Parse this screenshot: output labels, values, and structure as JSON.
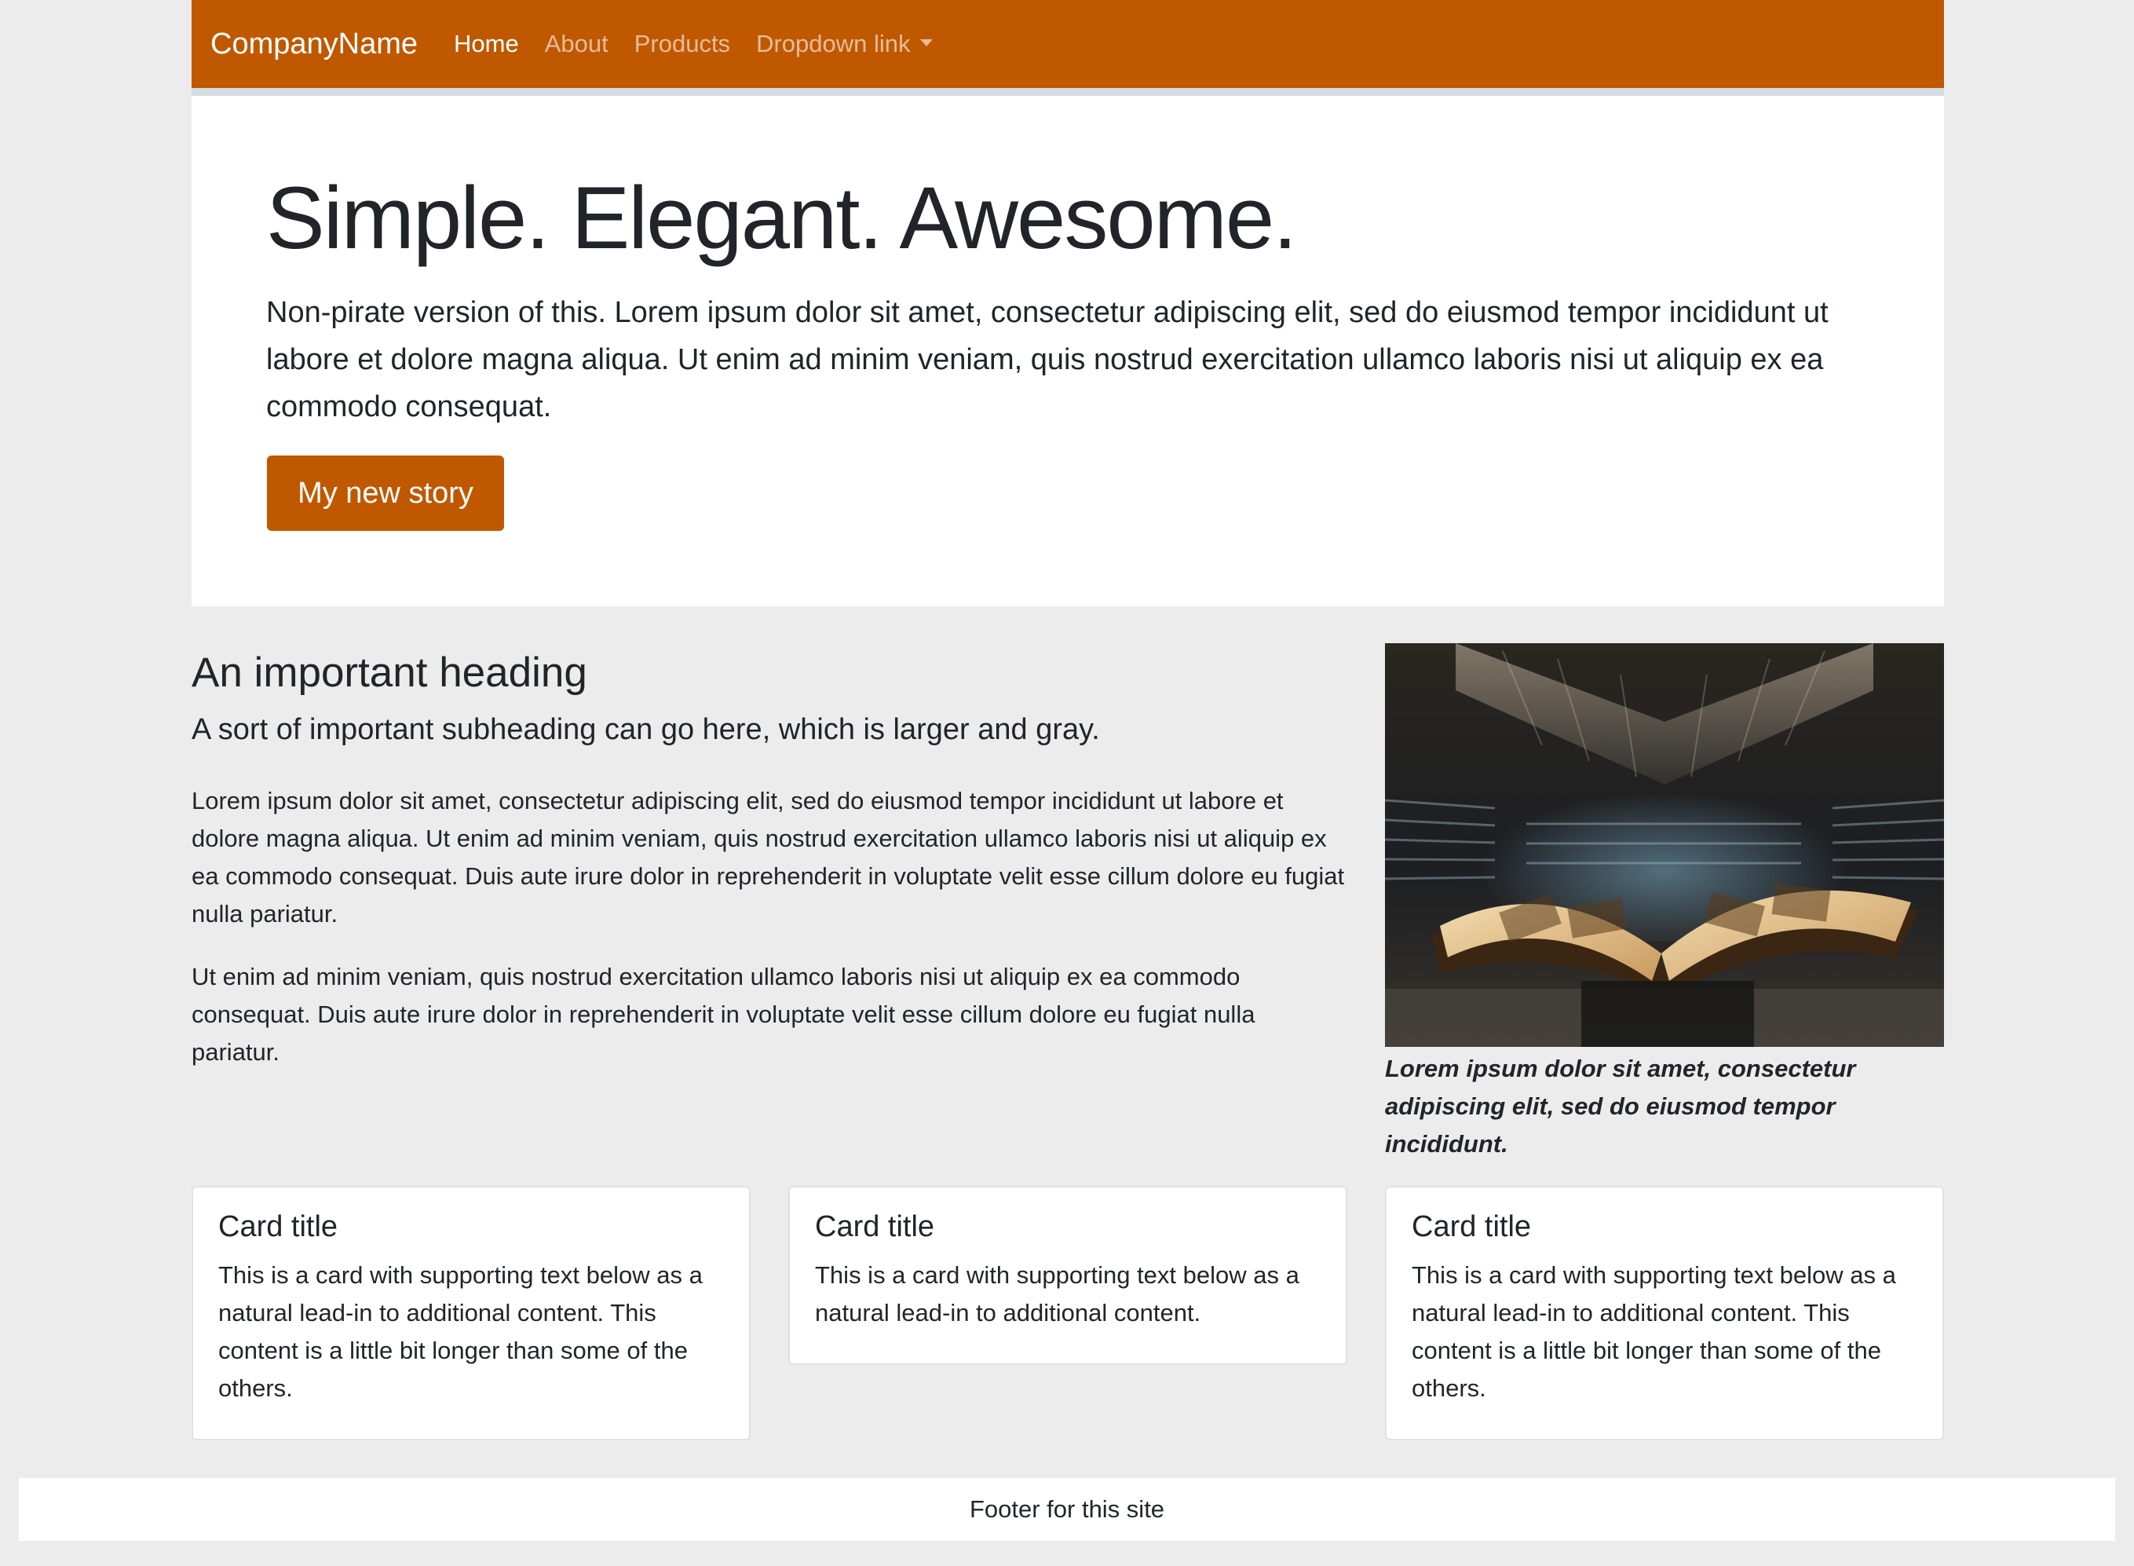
{
  "navbar": {
    "brand": "CompanyName",
    "items": [
      {
        "label": "Home",
        "active": true
      },
      {
        "label": "About",
        "active": false
      },
      {
        "label": "Products",
        "active": false
      },
      {
        "label": "Dropdown link",
        "active": false,
        "dropdown": true
      }
    ],
    "accent_color": "#c05800"
  },
  "hero": {
    "title": "Simple. Elegant. Awesome.",
    "text": "Non-pirate version of this. Lorem ipsum dolor sit amet, consectetur adipiscing elit, sed do eiusmod tempor incididunt ut labore et dolore magna aliqua. Ut enim ad minim veniam, quis nostrud exercitation ullamco laboris nisi ut aliquip ex ea commodo consequat.",
    "button_label": "My new story"
  },
  "content": {
    "heading": "An important heading",
    "subheading": "A sort of important subheading can go here, which is larger and gray.",
    "paragraphs": [
      "Lorem ipsum dolor sit amet, consectetur adipiscing elit, sed do eiusmod tempor incididunt ut labore et dolore magna aliqua. Ut enim ad minim veniam, quis nostrud exercitation ullamco laboris nisi ut aliquip ex ea commodo consequat. Duis aute irure dolor in reprehenderit in voluptate velit esse cillum dolore eu fugiat nulla pariatur.",
      "Ut enim ad minim veniam, quis nostrud exercitation ullamco laboris nisi ut aliquip ex ea commodo consequat. Duis aute irure dolor in reprehenderit in voluptate velit esse cillum dolore eu fugiat nulla pariatur."
    ],
    "image_caption": "Lorem ipsum dolor sit amet, consectetur adipiscing elit, sed do eiusmod tempor incididunt."
  },
  "cards": [
    {
      "title": "Card title",
      "text": "This is a card with supporting text below as a natural lead-in to additional content. This content is a little bit longer than some of the others."
    },
    {
      "title": "Card title",
      "text": "This is a card with supporting text below as a natural lead-in to additional content."
    },
    {
      "title": "Card title",
      "text": "This is a card with supporting text below as a natural lead-in to additional content. This content is a little bit longer than some of the others."
    }
  ],
  "footer": {
    "text": "Footer for this site"
  }
}
